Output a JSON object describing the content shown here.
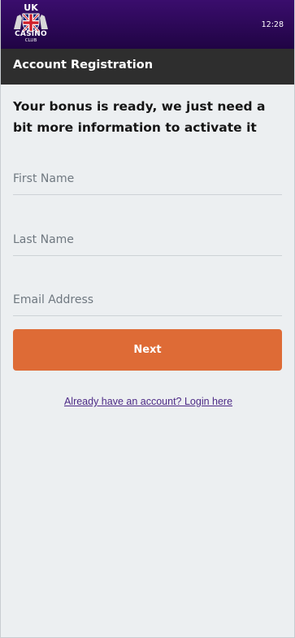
{
  "status_bar": {
    "logo": {
      "line1": "UK",
      "line2": "CASINO",
      "line3": "CLUB"
    },
    "time": "12:28"
  },
  "header": {
    "title": "Account Registration"
  },
  "main": {
    "heading": "Your bonus is ready, we just need a bit more information to activate it",
    "fields": {
      "first_name": {
        "placeholder": "First Name",
        "value": ""
      },
      "last_name": {
        "placeholder": "Last Name",
        "value": ""
      },
      "email": {
        "placeholder": "Email Address",
        "value": ""
      }
    },
    "next_label": "Next",
    "login_link": "Already have an account? Login here"
  },
  "colors": {
    "topbar": "#2b0857",
    "header": "#2e2e2e",
    "accent_button": "#de6b36",
    "link": "#4d2a86",
    "background": "#eceff1"
  },
  "icons": {
    "logo": "union-jack-shield-logo"
  }
}
